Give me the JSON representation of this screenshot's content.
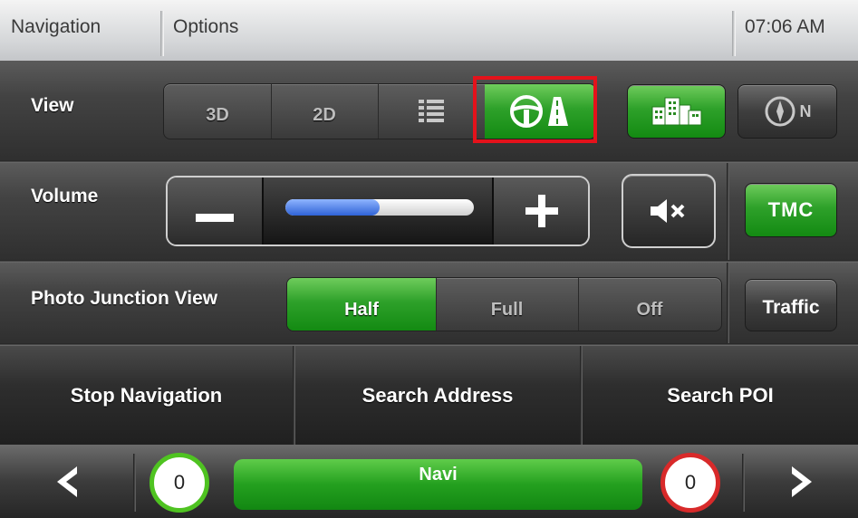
{
  "header": {
    "left_tab": "Navigation",
    "right_tab": "Options",
    "clock": "07:06 AM"
  },
  "view_row": {
    "label": "View",
    "segments": [
      {
        "label": "3D",
        "icon": null
      },
      {
        "label": "2D",
        "icon": null
      },
      {
        "label": "",
        "icon": "list-icon"
      },
      {
        "label": "",
        "icon": "steering-wheel-road-icon"
      }
    ],
    "selected_segment": "steering-wheel-road-icon",
    "buildings_icon": "city-buildings-icon",
    "compass_label": "N"
  },
  "volume_row": {
    "label": "Volume",
    "level": 0.5,
    "mute_icon": "speaker-mute-icon",
    "tmc_label": "TMC"
  },
  "junction_row": {
    "label": "Photo Junction View",
    "options": [
      "Half",
      "Full",
      "Off"
    ],
    "selected": "Half",
    "traffic_label": "Traffic"
  },
  "actions": {
    "stop": "Stop Navigation",
    "address": "Search Address",
    "poi": "Search POI"
  },
  "footer": {
    "left_count": "0",
    "center": "Navi",
    "right_count": "0"
  },
  "colors": {
    "accent_green": "#2ea12a",
    "highlight_red": "#e4121b",
    "left_ring": "#4fc321",
    "right_ring": "#d82a2a"
  }
}
